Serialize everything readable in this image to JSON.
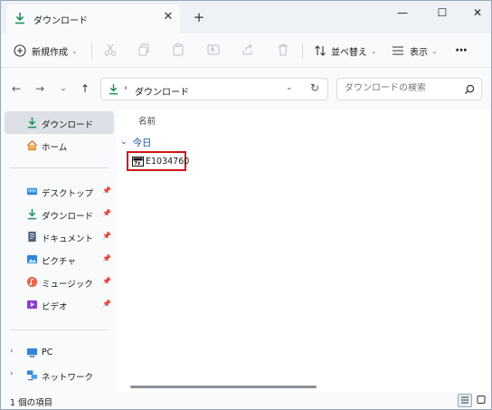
{
  "window": {
    "tab_title": "ダウンロード",
    "tab_close": "✕",
    "new_tab": "+",
    "minimize": "—",
    "maximize": "☐",
    "close": "✕"
  },
  "toolbar": {
    "new_label": "新規作成",
    "sort_label": "並べ替え",
    "view_label": "表示",
    "more_label": "···"
  },
  "address": {
    "path": "ダウンロード",
    "separator": "›",
    "search_placeholder": "ダウンロードの検索"
  },
  "sidebar": {
    "items": [
      {
        "label": "ダウンロード",
        "icon": "download-icon",
        "active": true
      },
      {
        "label": "ホーム",
        "icon": "home-icon"
      },
      {
        "label": "デスクトップ",
        "icon": "desktop-icon",
        "pinned": true
      },
      {
        "label": "ダウンロード",
        "icon": "download-icon",
        "pinned": true
      },
      {
        "label": "ドキュメント",
        "icon": "document-icon",
        "pinned": true
      },
      {
        "label": "ピクチャ",
        "icon": "pictures-icon",
        "pinned": true
      },
      {
        "label": "ミュージック",
        "icon": "music-icon",
        "pinned": true
      },
      {
        "label": "ビデオ",
        "icon": "video-icon",
        "pinned": true
      },
      {
        "label": "PC",
        "icon": "pc-icon",
        "expandable": true
      },
      {
        "label": "ネットワーク",
        "icon": "network-icon",
        "expandable": true
      }
    ]
  },
  "content": {
    "column_name": "名前",
    "group_label": "今日",
    "files": [
      {
        "name": "E1034760",
        "icon": "zip-archive-icon",
        "highlighted": true
      }
    ]
  },
  "status": {
    "item_count": "1 個の項目"
  },
  "colors": {
    "accent": "#1b4e99",
    "highlight_border": "#d11616",
    "download_green": "#1f8f5f"
  }
}
